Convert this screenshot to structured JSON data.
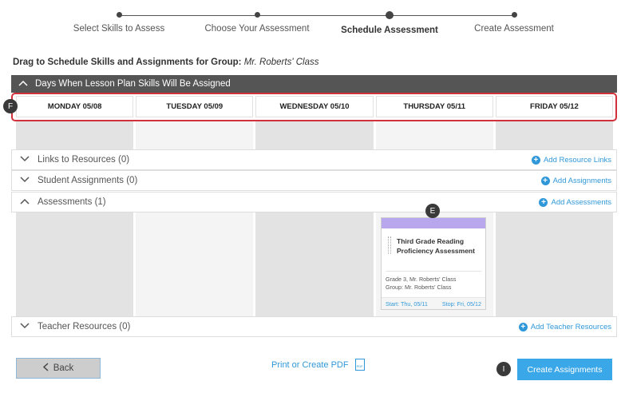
{
  "stepper": {
    "steps": [
      {
        "label": "Select Skills to Assess"
      },
      {
        "label": "Choose Your Assessment"
      },
      {
        "label": "Schedule Assessment"
      },
      {
        "label": "Create Assessment"
      }
    ]
  },
  "heading": {
    "prefix": "Drag to Schedule Skills and Assignments for Group:",
    "group": "Mr. Roberts' Class"
  },
  "days_panel": {
    "title": "Days When Lesson Plan Skills Will Be Assigned",
    "days": [
      "MONDAY 05/08",
      "TUESDAY 05/09",
      "WEDNESDAY 05/10",
      "THURSDAY 05/11",
      "FRIDAY 05/12"
    ],
    "badge": "F"
  },
  "sections": {
    "links": {
      "label": "Links to Resources (0)",
      "action": "Add Resource Links"
    },
    "student": {
      "label": "Student Assignments (0)",
      "action": "Add Assignments"
    },
    "assessments": {
      "label": "Assessments (1)",
      "action": "Add Assessments"
    },
    "teacher": {
      "label": "Teacher Resources (0)",
      "action": "Add Teacher Resources"
    }
  },
  "card": {
    "badge": "E",
    "title": "Third Grade Reading Proficiency Assessment",
    "meta_line1": "Grade 3, Mr. Roberts' Class",
    "meta_line2": "Group: Mr. Roberts' Class",
    "start": "Start: Thu, 05/11",
    "stop": "Stop: Fri, 05/12"
  },
  "footer": {
    "back": "Back",
    "pdf": "Print or Create PDF",
    "pdf_icon_text": "PDF",
    "create": "Create Assignments",
    "badge": "I"
  },
  "colors": {
    "accent": "#3098d8",
    "highlight": "#d0313b",
    "card_top": "#b9a7ee"
  }
}
